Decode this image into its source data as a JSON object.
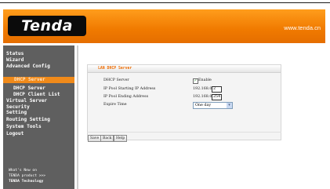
{
  "header": {
    "logo_text": "Tenda",
    "website": "www.tenda.cn"
  },
  "sidebar": {
    "items": [
      {
        "label": "Status"
      },
      {
        "label": "Wizard"
      },
      {
        "label": "Advanced Config"
      },
      {
        "label": "DHCP Server"
      },
      {
        "label": "DHCP Server"
      },
      {
        "label": "DHCP Client List"
      },
      {
        "label": "Virtual Server"
      },
      {
        "label": "Security"
      },
      {
        "label": "Setting"
      },
      {
        "label": "Routing Setting"
      },
      {
        "label": "System Tools"
      },
      {
        "label": "Logout"
      }
    ],
    "footer": [
      "What's New on",
      "TENDA product >>>",
      "TENDA Technology"
    ]
  },
  "panel": {
    "title": "LAN DHCP Server",
    "dhcp_server_label": "DHCP Server",
    "enable_label": "Enable",
    "enable_checked": true,
    "start_label": "IP Pool Starting IP Address",
    "start_prefix": "192.168.0.",
    "start_value": "2",
    "end_label": "IP Pool Ending Address",
    "end_prefix": "192.168.0.",
    "end_value": "254",
    "expire_label": "Expire Time",
    "expire_value": "One day"
  },
  "buttons": {
    "save": "Save",
    "back": "Back",
    "help": "Help"
  },
  "colors": {
    "accent": "#f07a00",
    "sidebar_bg": "#5f5f5f"
  }
}
